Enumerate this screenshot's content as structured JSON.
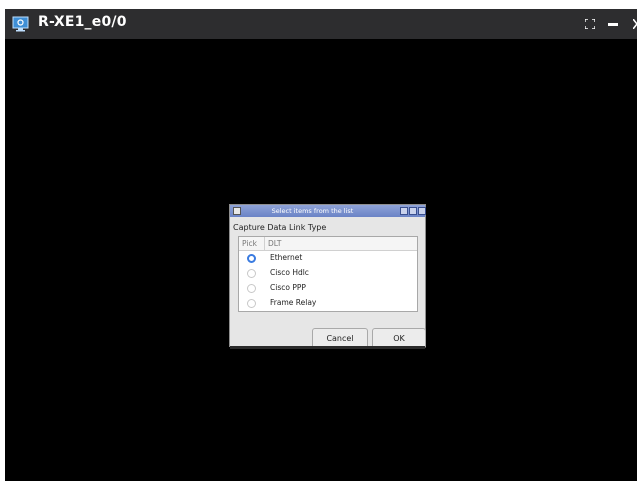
{
  "window": {
    "title": "R-XE1_e0/0",
    "icons": [
      "monitor-icon",
      "fullscreen-icon",
      "minimize-icon",
      "close-icon"
    ]
  },
  "dialog": {
    "title": "Select items from the list",
    "prompt": "Capture Data Link Type",
    "columns": {
      "pick": "Pick",
      "dlt": "DLT"
    },
    "items": [
      {
        "label": "Ethernet",
        "selected": true
      },
      {
        "label": "Cisco Hdlc",
        "selected": false
      },
      {
        "label": "Cisco PPP",
        "selected": false
      },
      {
        "label": "Frame Relay",
        "selected": false
      }
    ],
    "cancel_label": "Cancel",
    "ok_label": "OK"
  }
}
